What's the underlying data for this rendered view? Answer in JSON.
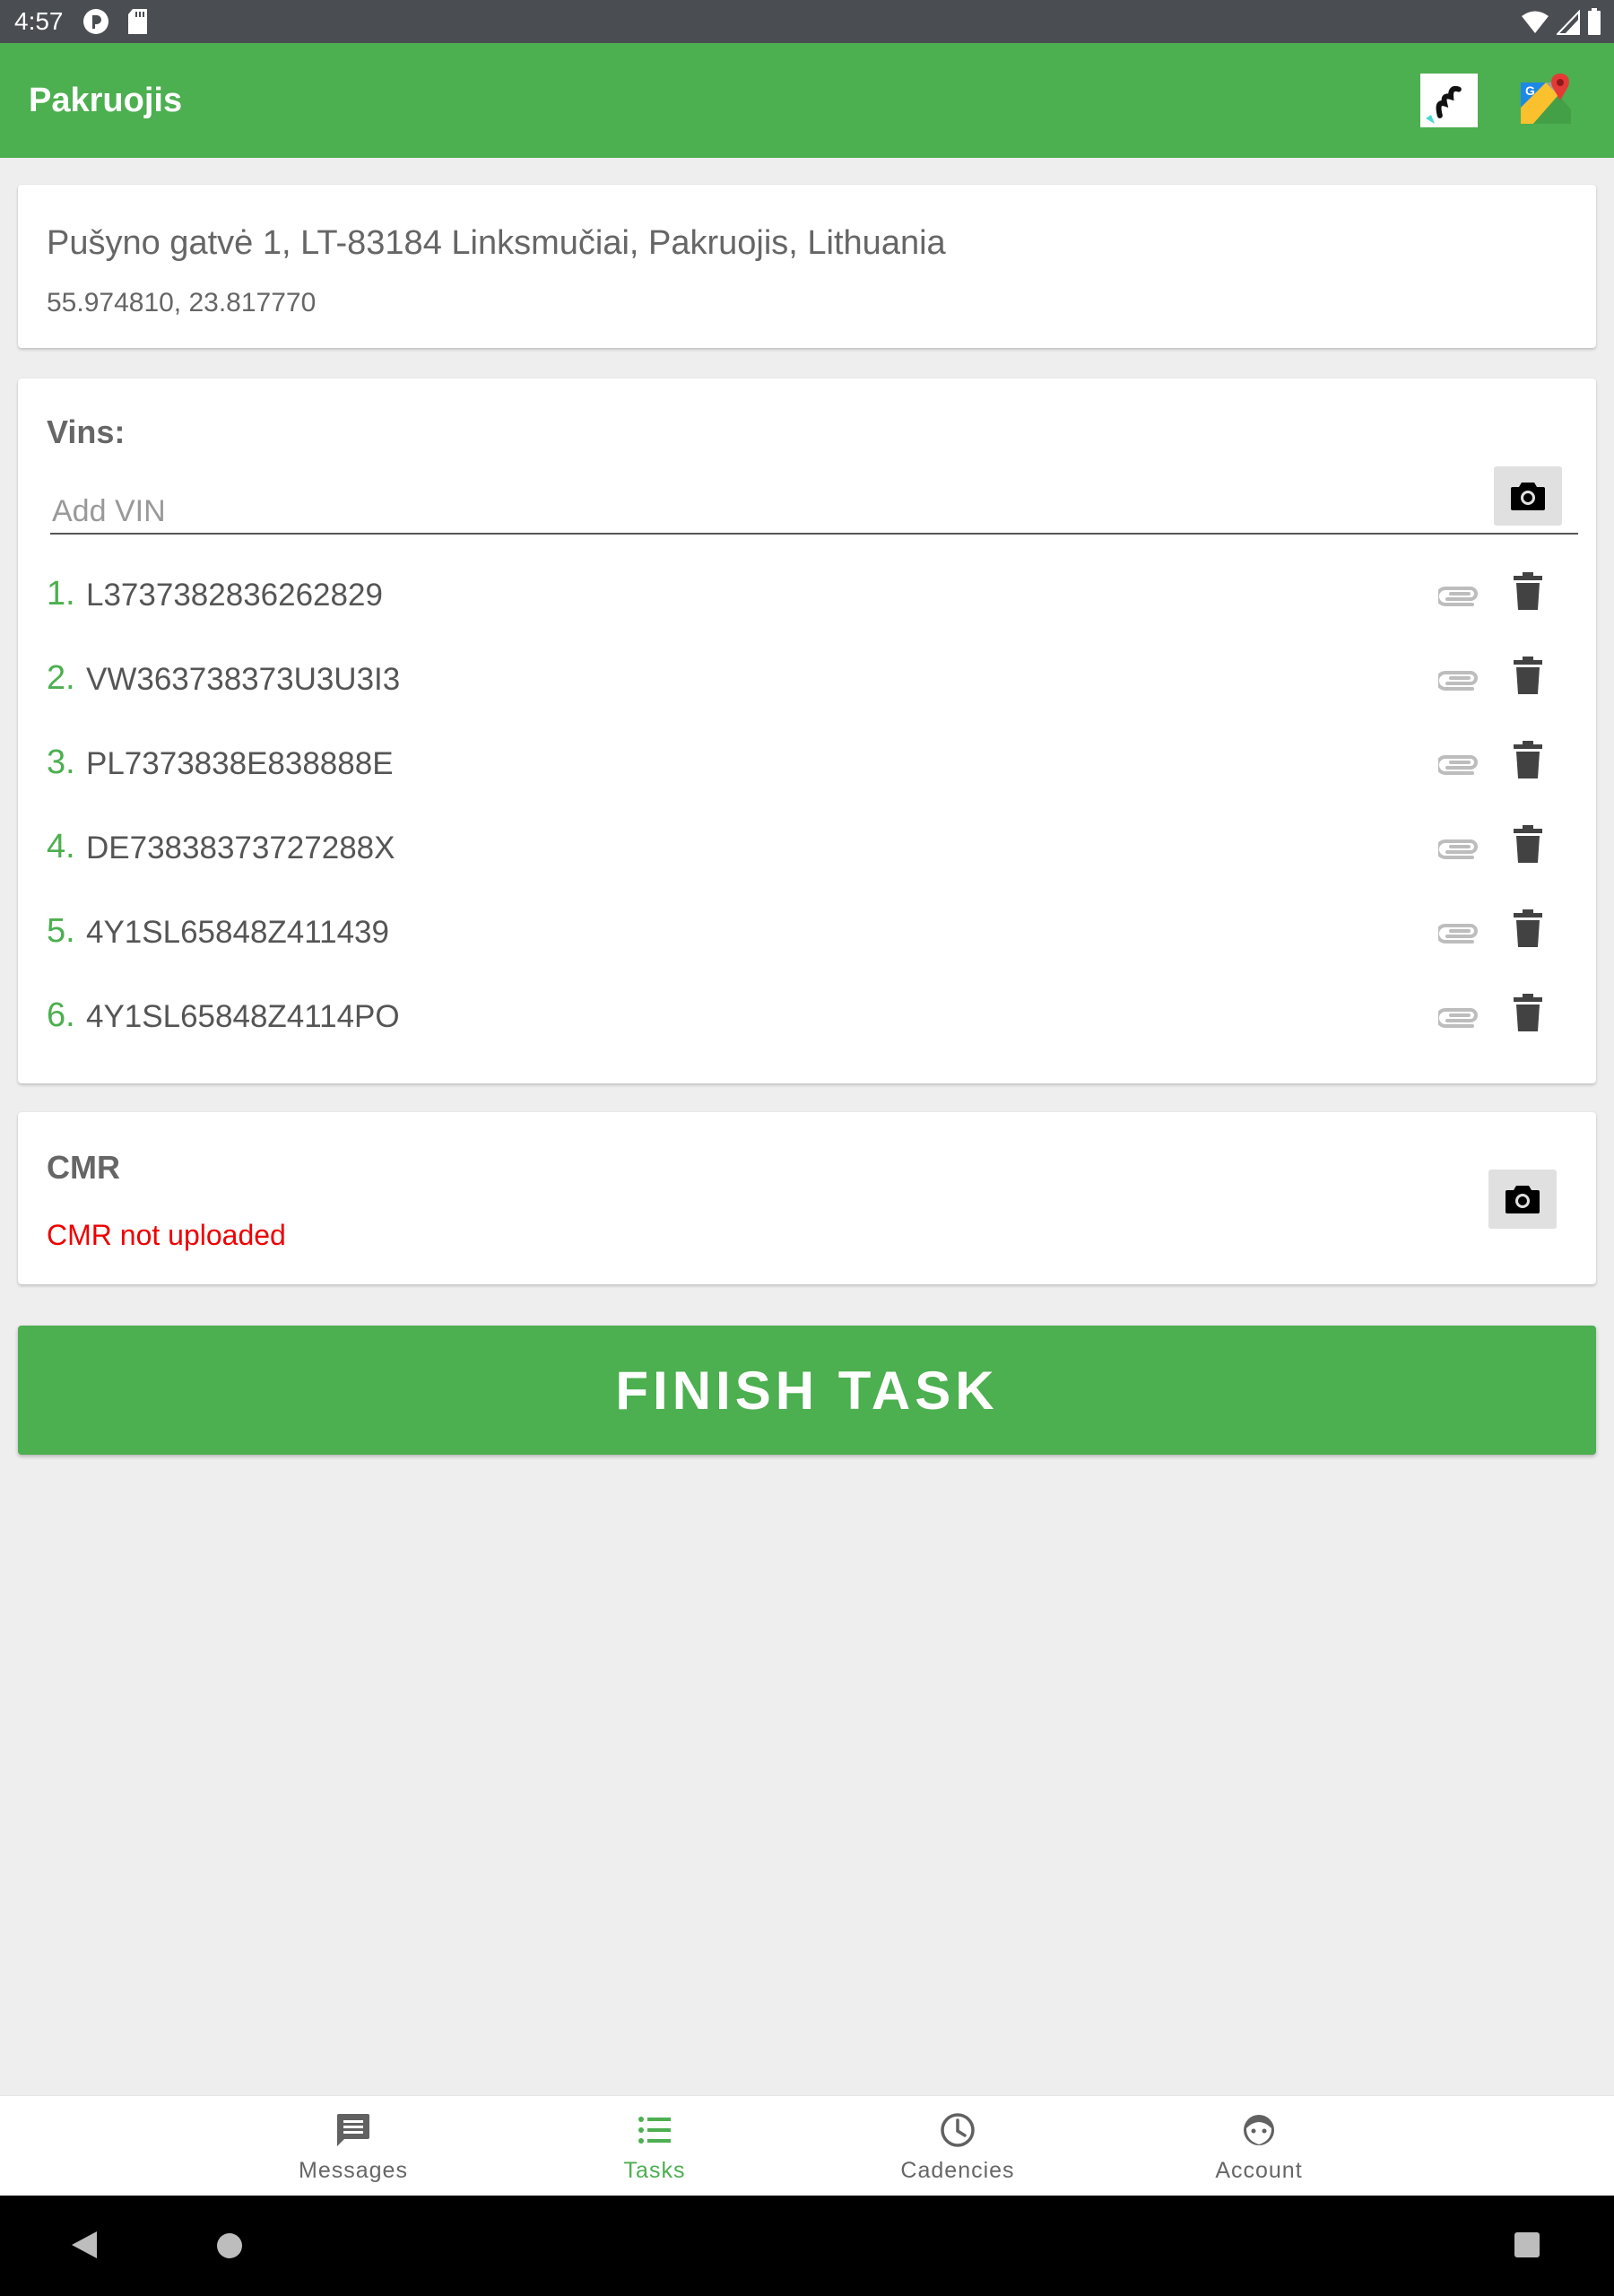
{
  "status_bar": {
    "time": "4:57"
  },
  "app_bar": {
    "title": "Pakruojis",
    "here_icon": "here-maps-icon",
    "maps_icon": "google-maps-icon"
  },
  "address": {
    "line": "Pušyno gatvė 1, LT-83184 Linksmučiai, Pakruojis, Lithuania",
    "coordinates": "55.974810, 23.817770"
  },
  "vins": {
    "title": "Vins:",
    "input_placeholder": "Add VIN",
    "input_value": "",
    "items": [
      {
        "num": "1.",
        "code": "L3737382836262829"
      },
      {
        "num": "2.",
        "code": "VW363738373U3U3I3"
      },
      {
        "num": "3.",
        "code": "PL7373838E838888E"
      },
      {
        "num": "4.",
        "code": "DE73838373727288X"
      },
      {
        "num": "5.",
        "code": "4Y1SL65848Z411439"
      },
      {
        "num": "6.",
        "code": "4Y1SL65848Z4114PO"
      }
    ]
  },
  "cmr": {
    "title": "CMR",
    "status": "CMR not uploaded"
  },
  "finish_button": "FINISH TASK",
  "bottom_nav": {
    "messages": "Messages",
    "tasks": "Tasks",
    "cadencies": "Cadencies",
    "account": "Account",
    "active": "tasks"
  },
  "colors": {
    "accent": "#4caf50",
    "error": "#ee0000",
    "status_bar": "#4a4d51"
  }
}
